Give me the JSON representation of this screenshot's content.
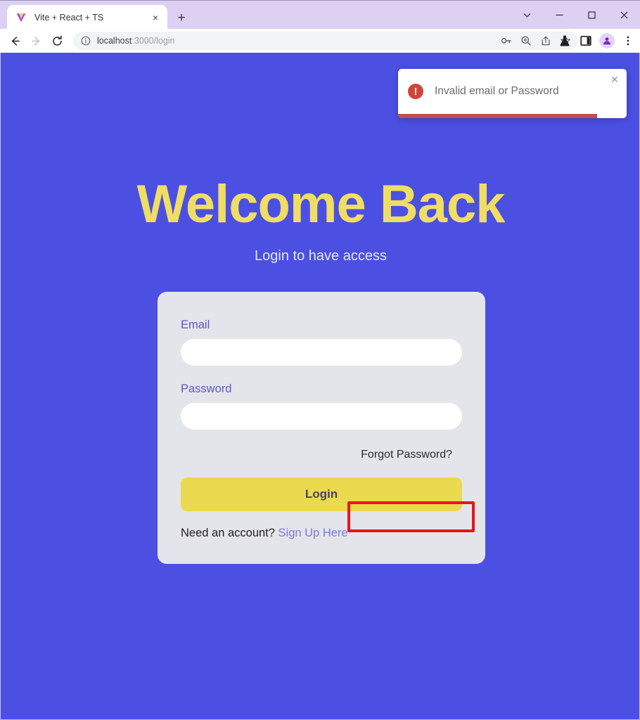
{
  "browser": {
    "tab": {
      "title": "Vite + React + TS",
      "favicon": "vite-logo-icon",
      "close_label": "×"
    },
    "new_tab_label": "+",
    "window_controls": {
      "tab_search_label": "⌄",
      "minimize_label": "–",
      "maximize_label": "□",
      "close_label": "✕"
    },
    "toolbar": {
      "back_label": "←",
      "forward_label": "→",
      "reload_label": "⟳",
      "omnibox": {
        "info_label": "ⓘ",
        "host": "localhost",
        "path": ":3000/login",
        "full_url": "localhost:3000/login"
      },
      "actions": [
        {
          "name": "password-key-icon",
          "label": "⚷"
        },
        {
          "name": "zoom-icon",
          "label": "⌕"
        },
        {
          "name": "share-icon",
          "label": "↗"
        },
        {
          "name": "bookmark-star-icon",
          "label": "☆"
        }
      ],
      "right_buttons": [
        {
          "name": "labs-flask-icon",
          "label": "⚗"
        },
        {
          "name": "side-panel-icon",
          "label": "▣"
        },
        {
          "name": "profile-avatar",
          "label": "●"
        },
        {
          "name": "chrome-menu-icon",
          "label": "⋮"
        }
      ]
    }
  },
  "toast": {
    "icon": "error-exclamation-icon",
    "icon_glyph": "!",
    "message": "Invalid email or Password",
    "close_label": "✕",
    "progress_percent": 87,
    "accent_color": "#d0453a",
    "progress_color": "#bb5147"
  },
  "page": {
    "background_color": "#4b50e2",
    "title": "Welcome Back",
    "title_color": "#f0de63",
    "subtitle": "Login to have access"
  },
  "form": {
    "card_color": "#e4e5ea",
    "email": {
      "label": "Email",
      "value": "",
      "placeholder": ""
    },
    "password": {
      "label": "Password",
      "value": "",
      "placeholder": ""
    },
    "forgot_password_label": "Forgot Password?",
    "login_button_label": "Login",
    "login_button_color": "#ebd94f",
    "signup_prompt": "Need an account?",
    "signup_link_label": "Sign Up Here",
    "signup_link_color": "#7b78e0"
  },
  "annotation": {
    "target": "forgot-password-link",
    "color": "#e8141e"
  }
}
